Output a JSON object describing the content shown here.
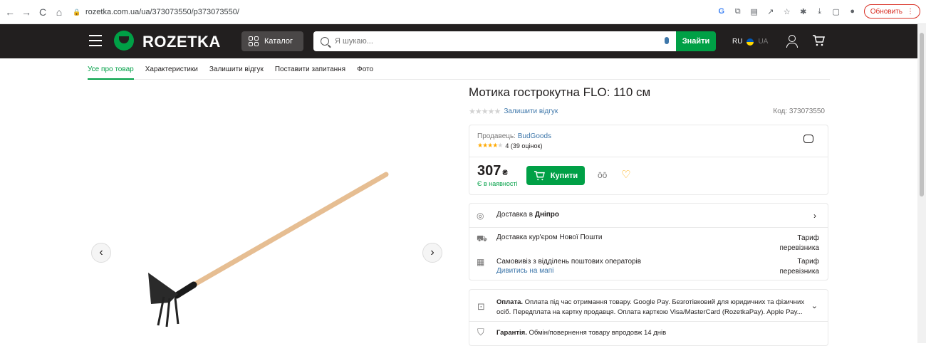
{
  "browser": {
    "url": "rozetka.com.ua/ua/373073550/p373073550/",
    "update_label": "Обновить",
    "nav_back": "←",
    "nav_forward": "→",
    "nav_reload": "C",
    "nav_home": "⌂"
  },
  "header": {
    "logo_text": "ROZETKA",
    "catalog_label": "Каталог",
    "search_placeholder": "Я шукаю...",
    "search_button": "Знайти",
    "lang_ru": "RU",
    "lang_ua": "UA"
  },
  "tabs": [
    "Усе про товар",
    "Характеристики",
    "Залишити відгук",
    "Поставити запитання",
    "Фото"
  ],
  "product": {
    "title": "Мотика гострокутна FLO: 110 см",
    "leave_review": "Залишити відгук",
    "code": "Код: 373073550",
    "stars": "★★★★★"
  },
  "seller": {
    "label": "Продавець:",
    "name": "BudGoods",
    "rating_stars_filled": "★★★★",
    "rating_stars_empty": "★",
    "rating_text": "4 (39 оцінок)"
  },
  "price": {
    "value": "307",
    "currency": "₴",
    "stock": "Є в наявності",
    "buy_label": "Купити"
  },
  "delivery": {
    "prefix": "Доставка в",
    "city": "Дніпро",
    "courier": "Доставка кур'єром Нової Пошти",
    "courier_tariff_1": "Тариф",
    "courier_tariff_2": "перевізника",
    "pickup": "Самовивіз з відділень поштових операторів",
    "pickup_link": "Дивитись на мапі",
    "pickup_tariff_1": "Тариф",
    "pickup_tariff_2": "перевізника"
  },
  "payment": {
    "label": "Оплата.",
    "text": "Оплата під час отримання товару. Google Pay. Безготівковий для юридичних та фізичних осіб. Передплата на картку продавця. Оплата карткою Visa/MasterCard (RozetkaPay). Apple Pay...",
    "guarantee_label": "Гарантія.",
    "guarantee_text": "Обмін/повернення товару впродовж 14 днів"
  },
  "colors": {
    "brand_green": "#00a046",
    "header_dark": "#221f1f",
    "link_blue": "#3e77aa",
    "star_gold": "#ffa900"
  }
}
